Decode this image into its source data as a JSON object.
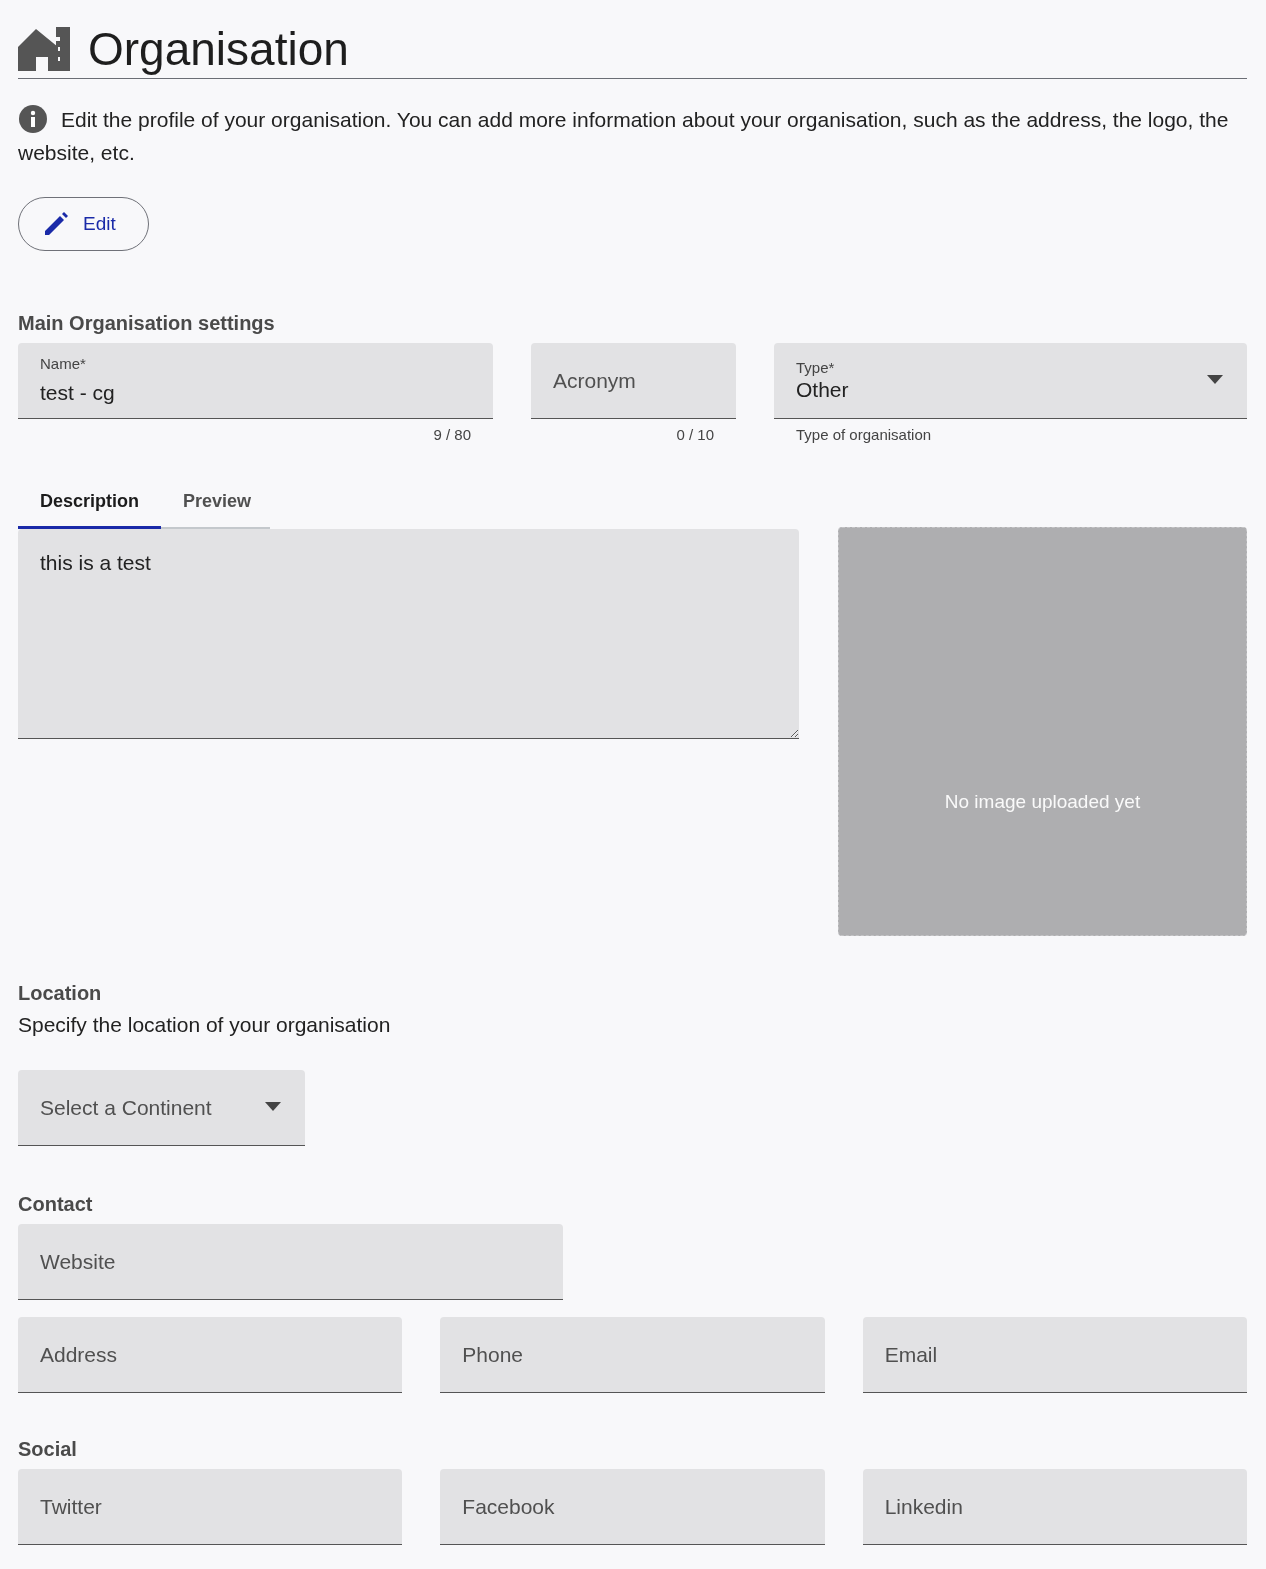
{
  "title": "Organisation",
  "info": "Edit the profile of your organisation. You can add more information about your organisation, such as the address, the logo, the website, etc.",
  "edit_button": {
    "label": "Edit"
  },
  "main_settings": {
    "heading": "Main Organisation settings",
    "fields": [
      {
        "kind": "text",
        "label": "Name*",
        "value": "test - cg",
        "counter": "9 / 80"
      },
      {
        "kind": "text",
        "placeholder": "Acronym",
        "counter": "0 / 10"
      },
      {
        "kind": "select",
        "label": "Type*",
        "value": "Other",
        "helper": "Type of organisation"
      }
    ]
  },
  "tabs": [
    {
      "label": "Description",
      "selected": true
    },
    {
      "label": "Preview",
      "selected": false
    }
  ],
  "description": {
    "value": "this is a test"
  },
  "image": {
    "message": "No image uploaded yet"
  },
  "location": {
    "heading": "Location",
    "text": "Specify the location of your organisation",
    "select": {
      "placeholder": "Select a Continent"
    }
  },
  "contact": {
    "heading": "Contact",
    "website": {
      "placeholder": "Website"
    },
    "fields": [
      {
        "placeholder": "Address"
      },
      {
        "placeholder": "Phone"
      },
      {
        "placeholder": "Email"
      }
    ]
  },
  "social": {
    "heading": "Social",
    "fields": [
      {
        "placeholder": "Twitter"
      },
      {
        "placeholder": "Facebook"
      },
      {
        "placeholder": "Linkedin"
      }
    ]
  }
}
